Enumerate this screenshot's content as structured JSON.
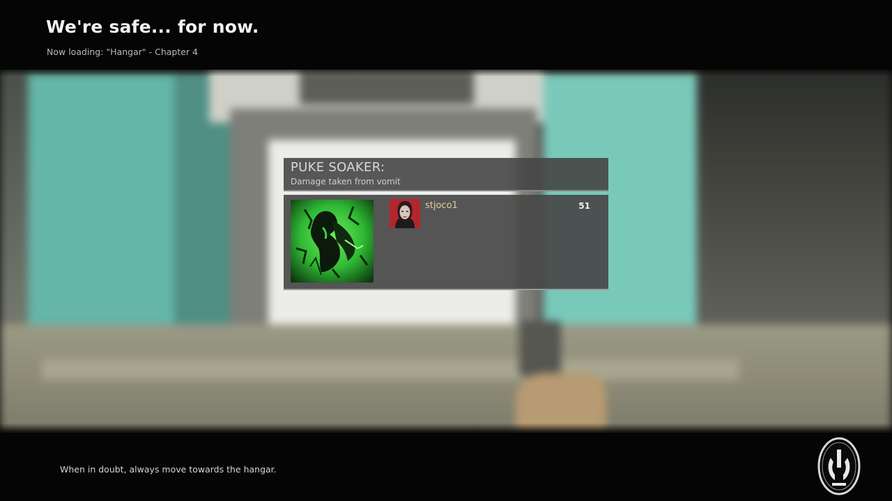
{
  "header": {
    "title": "We're safe... for now.",
    "loading_text": "Now loading: \"Hangar\" - Chapter 4"
  },
  "stat_panel": {
    "award_title": "PUKE SOAKER:",
    "award_description": "Damage taken from vomit",
    "award_icon": "boomer-vomit-award-icon",
    "players": [
      {
        "name": "stjoco1",
        "value": "51",
        "avatar": "player-avatar-icon"
      }
    ]
  },
  "footer": {
    "tip": "When in doubt, always move towards the hangar.",
    "logo_icon": "game-logo-icon"
  },
  "colors": {
    "background_bar": "#050505",
    "panel": "#474747",
    "award_icon_green": "#31c63a",
    "avatar_red": "#b3262b",
    "player_name": "#e3cfa0"
  }
}
